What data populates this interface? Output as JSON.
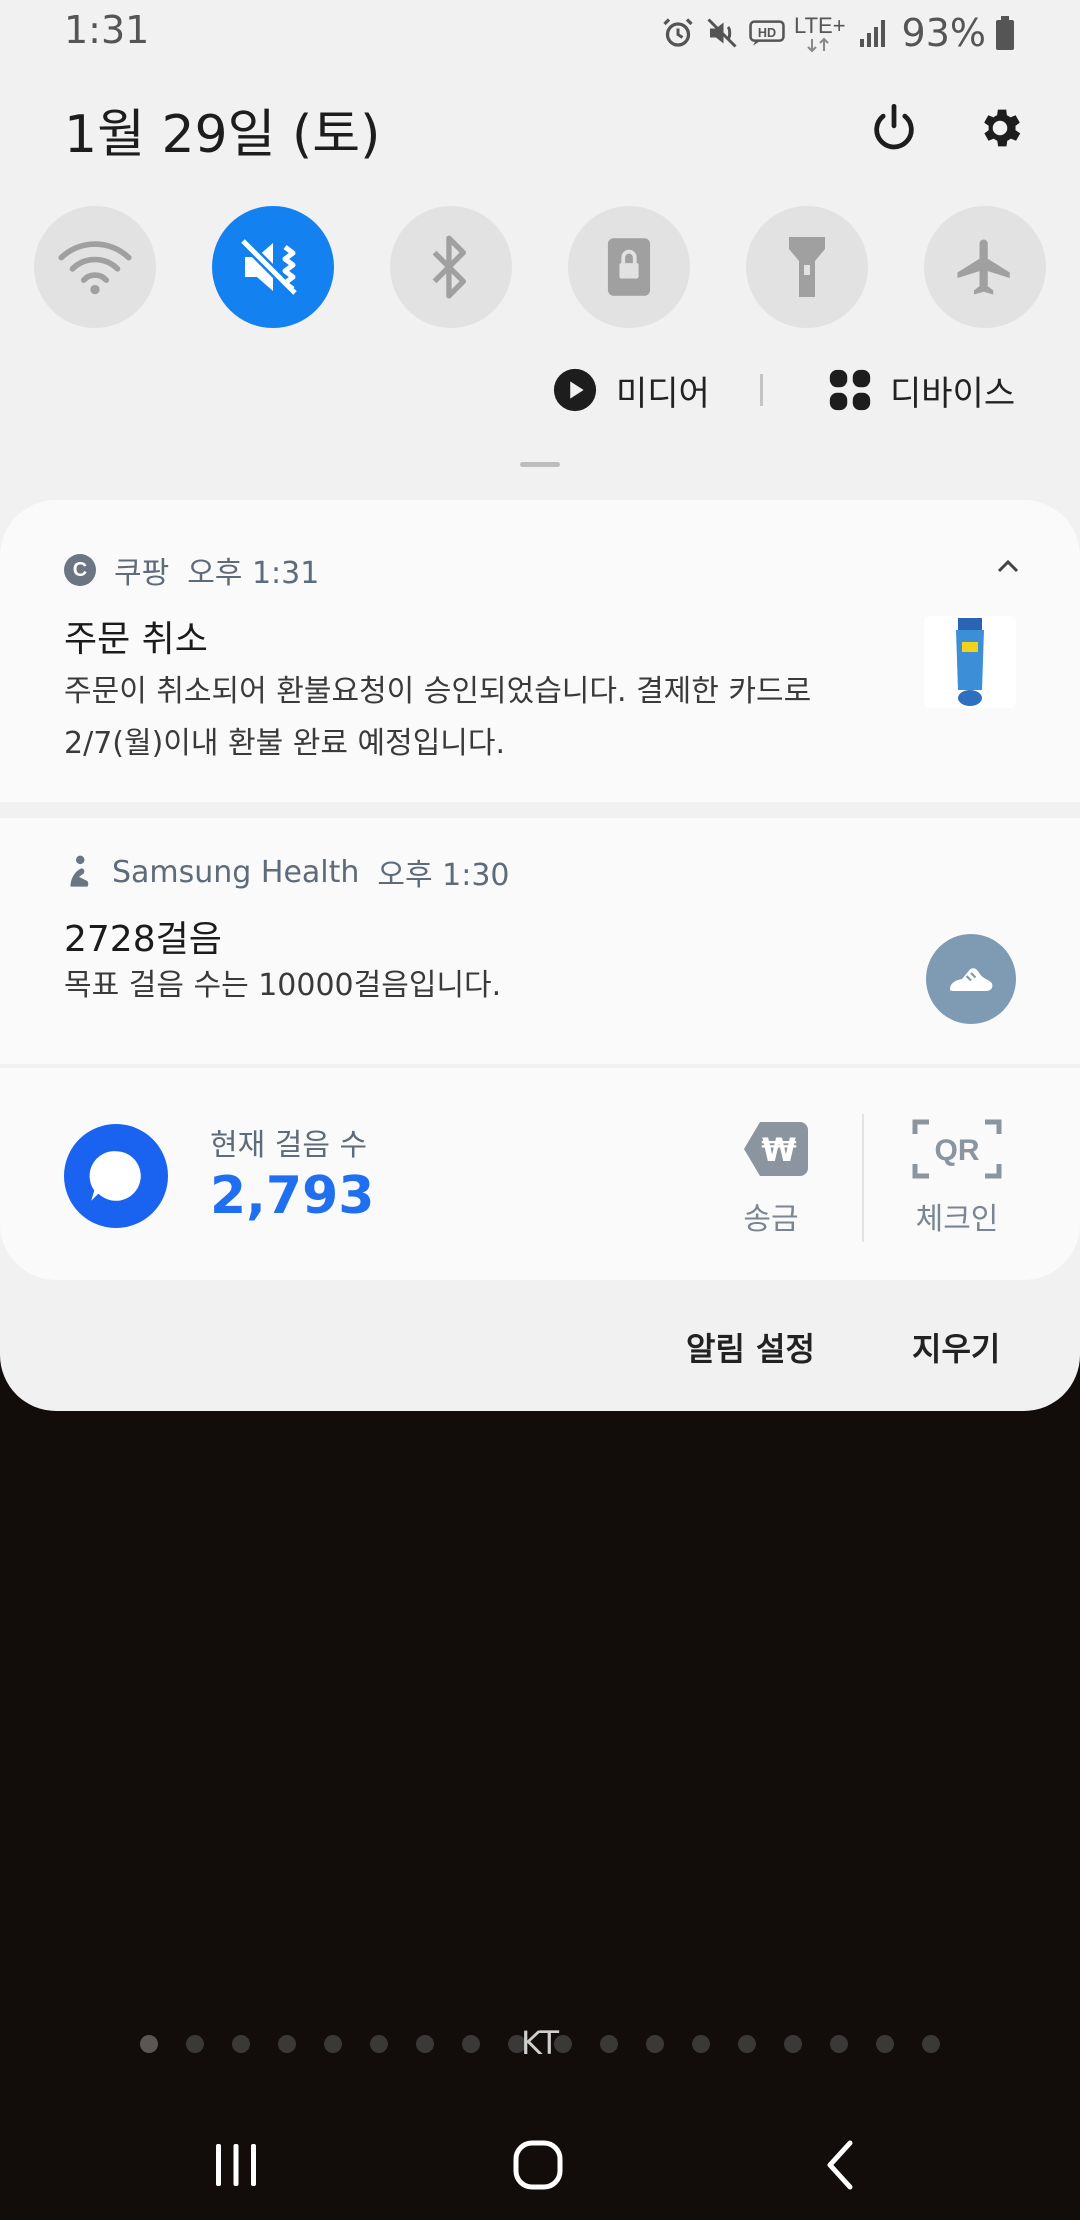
{
  "status_bar": {
    "time": "1:31",
    "network": "LTE+",
    "battery": "93%",
    "icons": [
      "alarm-icon",
      "mute-icon",
      "hd-voice-icon",
      "lte-icon",
      "signal-icon",
      "battery-icon"
    ]
  },
  "header": {
    "date": "1월 29일 (토)",
    "power_icon": "power-icon",
    "settings_icon": "gear-icon"
  },
  "quick_toggles": [
    {
      "name": "wifi",
      "icon": "wifi-icon",
      "active": false
    },
    {
      "name": "sound",
      "icon": "mute-icon",
      "active": true
    },
    {
      "name": "bluetooth",
      "icon": "bluetooth-icon",
      "active": false
    },
    {
      "name": "rotation-lock",
      "icon": "portrait-lock-icon",
      "active": false
    },
    {
      "name": "flashlight",
      "icon": "flashlight-icon",
      "active": false
    },
    {
      "name": "airplane",
      "icon": "airplane-icon",
      "active": false
    }
  ],
  "media_row": {
    "media_label": "미디어",
    "devices_label": "디바이스"
  },
  "notifications": [
    {
      "app": "쿠팡",
      "time": "오후 1:31",
      "title": "주문 취소",
      "body": "주문이 취소되어 환불요청이 승인되었습니다. 결제한 카드로 2/7(월)이내 환불 완료 예정입니다."
    },
    {
      "app": "Samsung Health",
      "time": "오후 1:30",
      "title": "2728걸음",
      "body": "목표 걸음 수는 10000걸음입니다."
    }
  ],
  "steps_widget": {
    "label": "현재 걸음 수",
    "value": "2,793",
    "send_label": "송금",
    "checkin_label": "체크인",
    "qr_text": "QR",
    "won_symbol": "₩"
  },
  "footer": {
    "settings_label": "알림 설정",
    "clear_label": "지우기"
  },
  "lockscreen": {
    "carrier": "KT",
    "page_dot_count": 18
  },
  "colors": {
    "accent": "#1481f0",
    "panel_bg": "#f1f1f1",
    "card_bg": "#fafafa",
    "wallpaper": "#120d0b",
    "steps_blue": "#1f6ff0"
  }
}
